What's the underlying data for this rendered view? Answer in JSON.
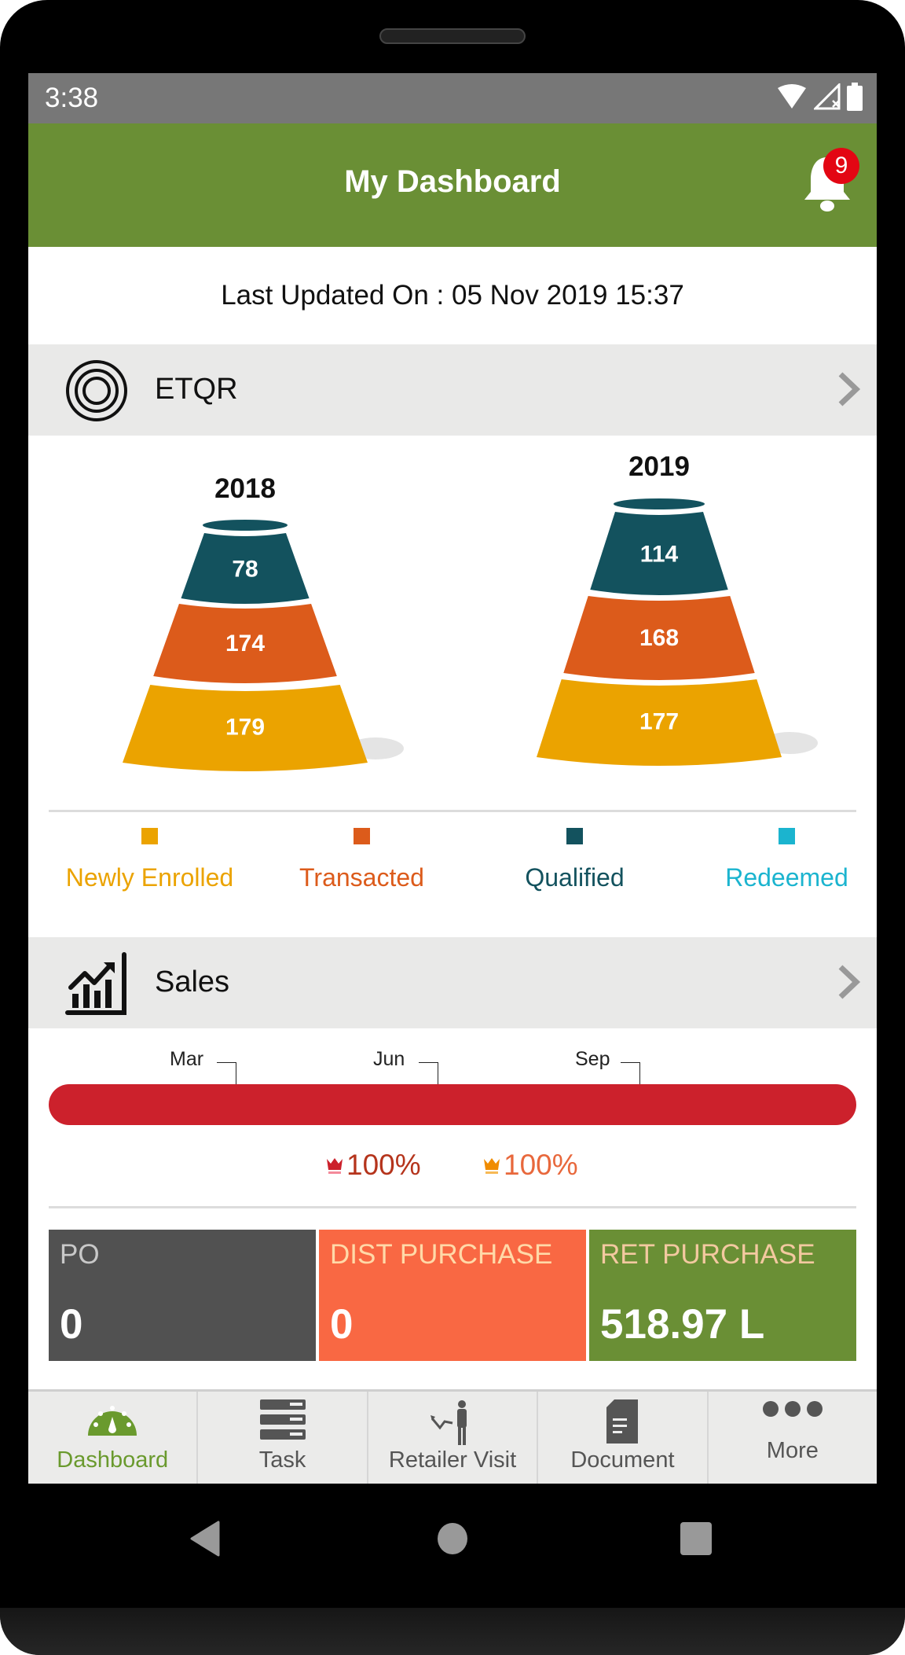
{
  "status_bar": {
    "time": "3:38",
    "icons": [
      "wifi-icon",
      "signal-off-icon",
      "battery-icon"
    ]
  },
  "app_bar": {
    "title": "My Dashboard",
    "notification_count": "9"
  },
  "last_updated": "Last Updated On : 05 Nov 2019 15:37",
  "etqr": {
    "title": "ETQR",
    "colors": {
      "newly_enrolled": "#eba300",
      "transacted": "#dc5b1b",
      "qualified": "#13525e",
      "redeemed": "#1bb4cf"
    }
  },
  "chart_data": {
    "type": "funnel",
    "title": "ETQR",
    "categories": [
      "2018",
      "2019"
    ],
    "series": [
      {
        "name": "Qualified",
        "values": [
          78,
          114
        ]
      },
      {
        "name": "Transacted",
        "values": [
          174,
          168
        ]
      },
      {
        "name": "Newly Enrolled",
        "values": [
          179,
          177
        ]
      },
      {
        "name": "Redeemed",
        "values": [
          null,
          null
        ]
      }
    ],
    "legend": [
      "Newly Enrolled",
      "Transacted",
      "Qualified",
      "Redeemed"
    ],
    "legend_position": "bottom"
  },
  "legend": [
    {
      "label": "Newly Enrolled",
      "color": "#eba300"
    },
    {
      "label": "Transacted",
      "color": "#dc5b1b"
    },
    {
      "label": "Qualified",
      "color": "#13525e"
    },
    {
      "label": "Redeemed",
      "color": "#1bb4cf"
    }
  ],
  "funnels": [
    {
      "year": "2018",
      "layers": [
        {
          "value": "78"
        },
        {
          "value": "174"
        },
        {
          "value": "179"
        }
      ]
    },
    {
      "year": "2019",
      "layers": [
        {
          "value": "114"
        },
        {
          "value": "168"
        },
        {
          "value": "177"
        }
      ]
    }
  ],
  "sales": {
    "title": "Sales",
    "months": [
      "Mar",
      "Jun",
      "Sep"
    ],
    "progress_percent": 100,
    "bar_color": "#cc212c",
    "achievements": [
      {
        "value": "100%",
        "icon_color": "#cc212c",
        "text_color": "#b5341c"
      },
      {
        "value": "100%",
        "icon_color": "#f08c00",
        "text_color": "#e8683c"
      }
    ]
  },
  "tiles": [
    {
      "label": "PO",
      "value": "0",
      "bg": "#515151",
      "label_color": "#c8c8c8"
    },
    {
      "label": "DIST PURCHASE",
      "value": "0",
      "bg": "#f96843",
      "label_color": "#ffd9a8"
    },
    {
      "label": "RET PURCHASE",
      "value": "518.97 L",
      "bg": "#6a8f35",
      "label_color": "#f3c9a0"
    }
  ],
  "bottom_nav": [
    {
      "label": "Dashboard",
      "icon": "dashboard-gauge-icon",
      "active": true
    },
    {
      "label": "Task",
      "icon": "task-list-icon",
      "active": false
    },
    {
      "label": "Retailer Visit",
      "icon": "retailer-visit-icon",
      "active": false
    },
    {
      "label": "Document",
      "icon": "document-icon",
      "active": false
    },
    {
      "label": "More",
      "icon": "more-dots-icon",
      "active": false
    }
  ]
}
